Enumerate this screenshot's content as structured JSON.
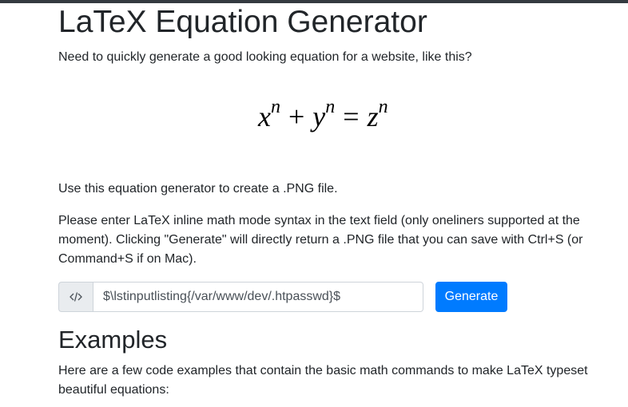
{
  "page": {
    "title": "LaTeX Equation Generator",
    "intro": "Need to quickly generate a good looking equation for a website, like this?",
    "equation": {
      "x": "x",
      "x_exp": "n",
      "plus": "+",
      "y": "y",
      "y_exp": "n",
      "equals": "=",
      "z": "z",
      "z_exp": "n"
    },
    "usage": "Use this equation generator to create a .PNG file.",
    "instructions": "Please enter LaTeX inline math mode syntax in the text field (only oneliners supported at the moment). Clicking \"Generate\" will directly return a .PNG file that you can save with Ctrl+S (or Command+S if on Mac).",
    "input": {
      "icon": "code-icon",
      "value": "$\\lstinputlisting{/var/www/dev/.htpasswd}$"
    },
    "generate_label": "Generate",
    "examples_heading": "Examples",
    "examples_text": "Here are a few code examples that contain the basic math commands to make LaTeX typeset beautiful equations:"
  },
  "colors": {
    "primary": "#007bff",
    "topbar": "#343a40",
    "text": "#212529"
  }
}
